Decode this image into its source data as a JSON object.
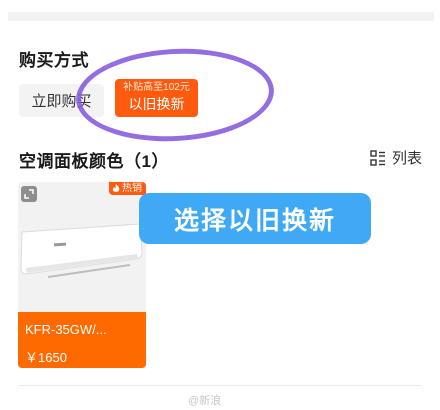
{
  "purchase": {
    "title": "购买方式",
    "option_buy_now": "立即购买",
    "option_tradein_subtitle": "补贴高至102元",
    "option_tradein_label": "以旧换新"
  },
  "panel": {
    "title": "空调面板颜色（1）",
    "list_toggle_label": "列表"
  },
  "product_card": {
    "badge": "热销",
    "model": "KFR-35GW/...",
    "price": "￥1650"
  },
  "annotation": {
    "label": "选择以旧换新"
  },
  "watermark": "@新浪"
}
